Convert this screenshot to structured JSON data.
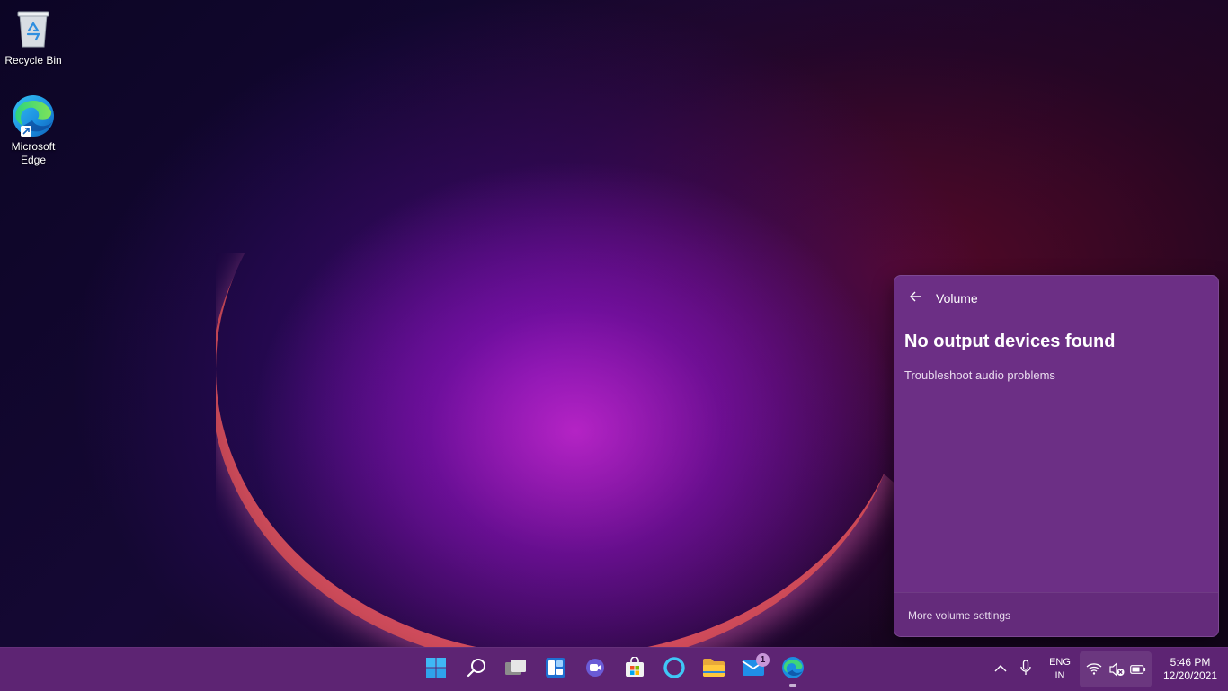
{
  "desktop": {
    "icons": [
      {
        "label": "Recycle Bin"
      },
      {
        "label_line1": "Microsoft",
        "label_line2": "Edge"
      }
    ]
  },
  "volume_flyout": {
    "title": "Volume",
    "heading": "No output devices found",
    "troubleshoot_link": "Troubleshoot audio problems",
    "footer_link": "More volume settings",
    "background_color": "#6c2f85"
  },
  "taskbar": {
    "background_color": "#5d2473",
    "pinned": [
      {
        "icon": "windows-start-icon"
      },
      {
        "icon": "search-icon"
      },
      {
        "icon": "task-view-icon"
      },
      {
        "icon": "widgets-icon"
      },
      {
        "icon": "chat-icon"
      },
      {
        "icon": "microsoft-store-icon"
      },
      {
        "icon": "cortana-icon"
      },
      {
        "icon": "file-explorer-icon"
      },
      {
        "icon": "mail-icon",
        "badge": "1"
      },
      {
        "icon": "edge-icon",
        "running": true
      }
    ],
    "tray": {
      "language_line1": "ENG",
      "language_line2": "IN",
      "time": "5:46 PM",
      "date": "12/20/2021"
    }
  }
}
